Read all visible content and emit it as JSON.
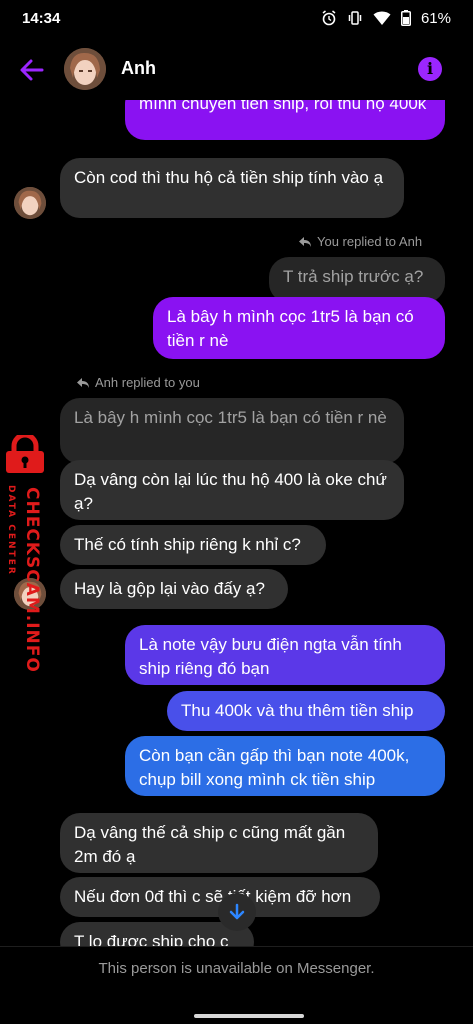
{
  "status_bar": {
    "time": "14:34",
    "battery": "61%",
    "icons": [
      "alarm-icon",
      "vibrate-icon",
      "wifi-icon",
      "battery-icon"
    ]
  },
  "header": {
    "contact_name": "Anh",
    "back_icon": "arrow-left-icon",
    "info_icon": "info-icon",
    "accent_color": "#9b26ff"
  },
  "messages": [
    {
      "side": "out",
      "text": "mình chuyển tiền ship, rồi thu hộ 400k"
    },
    {
      "side": "in",
      "text": "Còn cod thì thu hộ cả tiền ship tính vào ạ"
    },
    {
      "side": "meta",
      "text": "You replied to Anh"
    },
    {
      "side": "quote",
      "text": "T trả ship trước ạ?"
    },
    {
      "side": "out",
      "text": "Là bây h mình cọc 1tr5 là bạn có tiền r nè"
    },
    {
      "side": "meta",
      "text": "Anh replied to you"
    },
    {
      "side": "quote",
      "text": "Là bây h mình cọc 1tr5 là bạn có tiền r nè"
    },
    {
      "side": "in",
      "text": "Dạ vâng còn lại lúc thu hộ 400 là oke chứ ạ?"
    },
    {
      "side": "in",
      "text": "Thế có tính ship riêng k nhỉ c?"
    },
    {
      "side": "in",
      "text": "Hay là gộp lại vào đấy ạ?"
    },
    {
      "side": "out",
      "text": "Là note vậy bưu điện ngta vẫn tính ship riêng đó bạn"
    },
    {
      "side": "out",
      "text": "Thu 400k và thu thêm tiền ship"
    },
    {
      "side": "out",
      "text": "Còn bạn cần gấp thì bạn note 400k, chụp bill xong mình ck tiền ship"
    },
    {
      "side": "in",
      "text": "Dạ vâng thế cả ship c cũng mất gần 2m đó ạ"
    },
    {
      "side": "in",
      "text": "Nếu đơn 0đ thì c sẽ tiết kiệm đỡ hơn"
    },
    {
      "side": "in",
      "text": "T lo được ship cho c"
    }
  ],
  "watermark": {
    "line1": "CHECKSCAM.INFO",
    "line2": "DATA CENTER",
    "color": "#e01b1b"
  },
  "footer": {
    "notice": "This person is unavailable on Messenger."
  },
  "colors": {
    "incoming_bubble": "#303030",
    "outgoing_purple": "#8a12f2",
    "outgoing_indigo": "#5b38e8",
    "outgoing_blue": "#2c6ee6"
  }
}
